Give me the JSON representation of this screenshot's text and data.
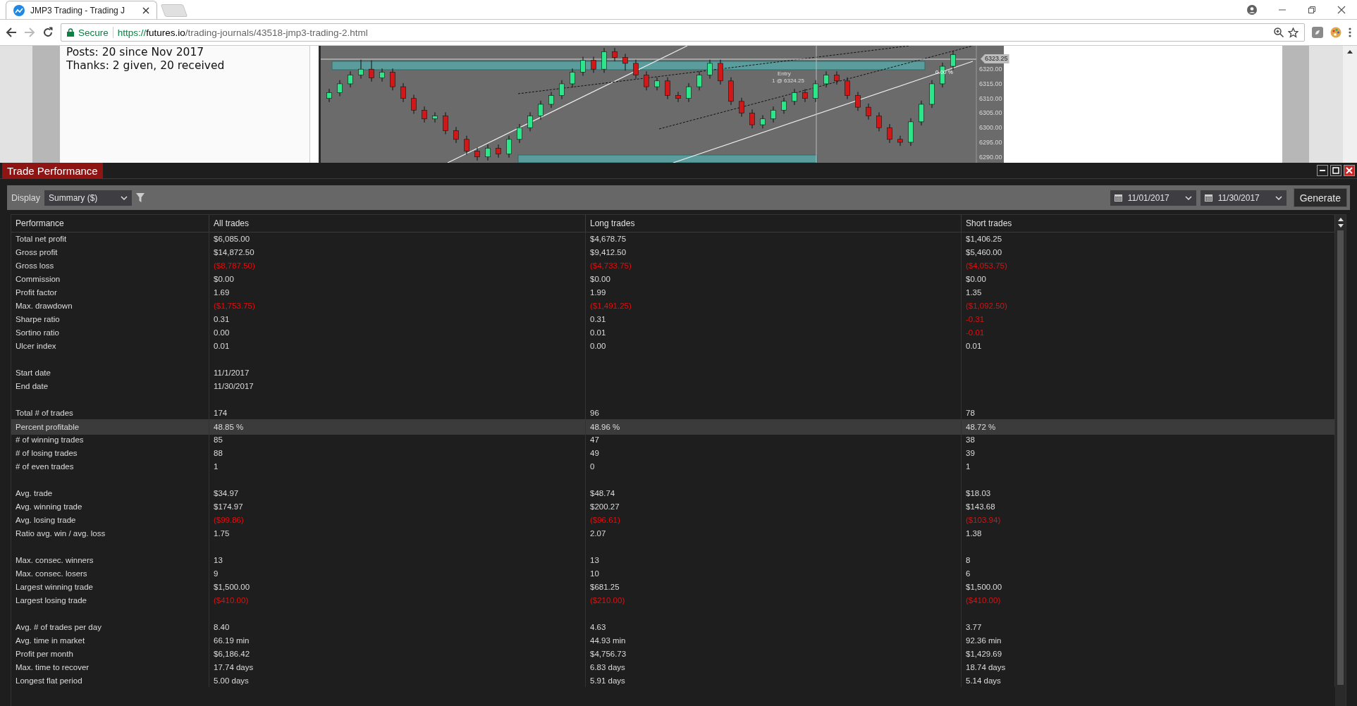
{
  "browser": {
    "tab_title": "JMP3 Trading - Trading J",
    "secure_label": "Secure",
    "url_scheme": "https://",
    "url_host": "futures.io",
    "url_path": "/trading-journals/43518-jmp3-trading-2.html"
  },
  "forum_post": {
    "lines": [
      "Posts: 20 since Nov 2017",
      "Thanks: 2 given, 20 received"
    ]
  },
  "chart": {
    "price_marker": "6323.25",
    "entry_label": "Entry",
    "entry_detail": "1 @ 6324.25",
    "percent_label": "0.00 %",
    "chart_data": {
      "type": "candlestick",
      "ylim": [
        6288,
        6328
      ],
      "yticks": [
        {
          "value": 6320,
          "label": "6320.00"
        },
        {
          "value": 6315,
          "label": "6315.00"
        },
        {
          "value": 6310,
          "label": "6310.00"
        },
        {
          "value": 6305,
          "label": "6305.00"
        },
        {
          "value": 6300,
          "label": "6300.00"
        },
        {
          "value": 6295,
          "label": "6295.00"
        },
        {
          "value": 6290,
          "label": "6290.00"
        }
      ],
      "ohlc": [
        [
          6310,
          6313.25,
          6308.75,
          6312
        ],
        [
          6312,
          6316.25,
          6310.75,
          6315
        ],
        [
          6315,
          6319.25,
          6313.75,
          6318
        ],
        [
          6318,
          6323.25,
          6316.75,
          6320
        ],
        [
          6320,
          6323,
          6315.75,
          6317
        ],
        [
          6317,
          6320.25,
          6315.75,
          6319
        ],
        [
          6319,
          6320.25,
          6312.75,
          6314
        ],
        [
          6314,
          6315.25,
          6308.75,
          6310
        ],
        [
          6310,
          6311.25,
          6304.75,
          6306
        ],
        [
          6306,
          6307.25,
          6301.75,
          6303
        ],
        [
          6303,
          6305.25,
          6301.75,
          6304
        ],
        [
          6304,
          6305.25,
          6297.75,
          6299
        ],
        [
          6299,
          6300.25,
          6294.75,
          6296
        ],
        [
          6296,
          6297.25,
          6290.75,
          6292
        ],
        [
          6292,
          6293.25,
          6288.75,
          6290
        ],
        [
          6290,
          6294.25,
          6288.75,
          6293
        ],
        [
          6293,
          6294.25,
          6289.75,
          6291
        ],
        [
          6291,
          6297.25,
          6289.75,
          6296
        ],
        [
          6296,
          6301.25,
          6294.75,
          6300
        ],
        [
          6300,
          6305.25,
          6298.75,
          6304
        ],
        [
          6304,
          6309.25,
          6302.75,
          6308
        ],
        [
          6308,
          6312.25,
          6306.75,
          6311
        ],
        [
          6311,
          6316.25,
          6309.75,
          6315
        ],
        [
          6315,
          6320.25,
          6313.75,
          6319
        ],
        [
          6319,
          6324.25,
          6317.75,
          6323
        ],
        [
          6323,
          6324.25,
          6318.75,
          6320
        ],
        [
          6320,
          6327.25,
          6318.75,
          6326
        ],
        [
          6326,
          6327.25,
          6322.75,
          6324
        ],
        [
          6324,
          6325.25,
          6319.5,
          6322
        ],
        [
          6322,
          6323.25,
          6316.75,
          6318
        ],
        [
          6318,
          6319.25,
          6312.75,
          6314
        ],
        [
          6314,
          6317.25,
          6312.75,
          6316
        ],
        [
          6316,
          6317.25,
          6309.75,
          6311
        ],
        [
          6311,
          6312.25,
          6308.75,
          6310
        ],
        [
          6310,
          6315.25,
          6308.75,
          6314
        ],
        [
          6314,
          6319.25,
          6312.75,
          6318
        ],
        [
          6318,
          6323.25,
          6316.75,
          6322
        ],
        [
          6322,
          6323.25,
          6314.75,
          6316
        ],
        [
          6316,
          6317.25,
          6307.75,
          6309
        ],
        [
          6309,
          6310.25,
          6303.75,
          6305
        ],
        [
          6305,
          6306.25,
          6299.75,
          6301
        ],
        [
          6301,
          6304.25,
          6299.75,
          6303
        ],
        [
          6303,
          6307.25,
          6301.75,
          6306
        ],
        [
          6306,
          6310.25,
          6304.75,
          6309
        ],
        [
          6309,
          6313.25,
          6307.75,
          6312
        ],
        [
          6312,
          6313.25,
          6308.75,
          6310
        ],
        [
          6310,
          6316.25,
          6308.75,
          6315
        ],
        [
          6315,
          6319.25,
          6313.75,
          6318
        ],
        [
          6318,
          6319.25,
          6314.75,
          6316
        ],
        [
          6316,
          6317.25,
          6309.75,
          6311
        ],
        [
          6311,
          6312.25,
          6305.75,
          6307
        ],
        [
          6307,
          6308.25,
          6302.75,
          6304
        ],
        [
          6304,
          6305.25,
          6298.75,
          6300
        ],
        [
          6300,
          6301.25,
          6294.75,
          6296
        ],
        [
          6296,
          6297.25,
          6293.75,
          6295
        ],
        [
          6295,
          6303.25,
          6293.75,
          6302
        ],
        [
          6302,
          6309.25,
          6300.75,
          6308
        ],
        [
          6308,
          6316.25,
          6306.75,
          6315
        ],
        [
          6315,
          6322.25,
          6313.75,
          6321
        ],
        [
          6321,
          6326.25,
          6319.75,
          6325
        ]
      ]
    }
  },
  "window": {
    "title": "Trade Performance"
  },
  "toolbar": {
    "display_label": "Display",
    "display_value": "Summary ($)",
    "start_date": "11/01/2017",
    "end_date": "11/30/2017",
    "generate": "Generate"
  },
  "table": {
    "columns": [
      "Performance",
      "All trades",
      "Long trades",
      "Short trades"
    ],
    "rows": [
      {
        "kind": "metric",
        "label": "Total net profit",
        "selected": false,
        "values": [
          {
            "text": "$6,085.00",
            "negative": false
          },
          {
            "text": "$4,678.75",
            "negative": false
          },
          {
            "text": "$1,406.25",
            "negative": false
          }
        ]
      },
      {
        "kind": "metric",
        "label": "Gross profit",
        "selected": false,
        "values": [
          {
            "text": "$14,872.50",
            "negative": false
          },
          {
            "text": "$9,412.50",
            "negative": false
          },
          {
            "text": "$5,460.00",
            "negative": false
          }
        ]
      },
      {
        "kind": "metric",
        "label": "Gross loss",
        "selected": false,
        "values": [
          {
            "text": "($8,787.50)",
            "negative": true
          },
          {
            "text": "($4,733.75)",
            "negative": true
          },
          {
            "text": "($4,053.75)",
            "negative": true
          }
        ]
      },
      {
        "kind": "metric",
        "label": "Commission",
        "selected": false,
        "values": [
          {
            "text": "$0.00",
            "negative": false
          },
          {
            "text": "$0.00",
            "negative": false
          },
          {
            "text": "$0.00",
            "negative": false
          }
        ]
      },
      {
        "kind": "metric",
        "label": "Profit factor",
        "selected": false,
        "values": [
          {
            "text": "1.69",
            "negative": false
          },
          {
            "text": "1.99",
            "negative": false
          },
          {
            "text": "1.35",
            "negative": false
          }
        ]
      },
      {
        "kind": "metric",
        "label": "Max. drawdown",
        "selected": false,
        "values": [
          {
            "text": "($1,753.75)",
            "negative": true
          },
          {
            "text": "($1,491.25)",
            "negative": true
          },
          {
            "text": "($1,092.50)",
            "negative": true
          }
        ]
      },
      {
        "kind": "metric",
        "label": "Sharpe ratio",
        "selected": false,
        "values": [
          {
            "text": "0.31",
            "negative": false
          },
          {
            "text": "0.31",
            "negative": false
          },
          {
            "text": "-0.31",
            "negative": true
          }
        ]
      },
      {
        "kind": "metric",
        "label": "Sortino ratio",
        "selected": false,
        "values": [
          {
            "text": "0.00",
            "negative": false
          },
          {
            "text": "0.01",
            "negative": false
          },
          {
            "text": "-0.01",
            "negative": true
          }
        ]
      },
      {
        "kind": "metric",
        "label": "Ulcer index",
        "selected": false,
        "values": [
          {
            "text": "0.01",
            "negative": false
          },
          {
            "text": "0.00",
            "negative": false
          },
          {
            "text": "0.01",
            "negative": false
          }
        ]
      },
      {
        "kind": "spacer"
      },
      {
        "kind": "metric",
        "label": "Start date",
        "selected": false,
        "values": [
          {
            "text": "11/1/2017",
            "negative": false
          }
        ]
      },
      {
        "kind": "metric",
        "label": "End date",
        "selected": false,
        "values": [
          {
            "text": "11/30/2017",
            "negative": false
          }
        ]
      },
      {
        "kind": "spacer"
      },
      {
        "kind": "metric",
        "label": "Total # of trades",
        "selected": false,
        "values": [
          {
            "text": "174",
            "negative": false
          },
          {
            "text": "96",
            "negative": false
          },
          {
            "text": "78",
            "negative": false
          }
        ]
      },
      {
        "kind": "metric",
        "label": "Percent profitable",
        "selected": true,
        "values": [
          {
            "text": "48.85 %",
            "negative": false
          },
          {
            "text": "48.96 %",
            "negative": false
          },
          {
            "text": "48.72 %",
            "negative": false
          }
        ]
      },
      {
        "kind": "metric",
        "label": "# of winning trades",
        "selected": false,
        "values": [
          {
            "text": "85",
            "negative": false
          },
          {
            "text": "47",
            "negative": false
          },
          {
            "text": "38",
            "negative": false
          }
        ]
      },
      {
        "kind": "metric",
        "label": "# of losing trades",
        "selected": false,
        "values": [
          {
            "text": "88",
            "negative": false
          },
          {
            "text": "49",
            "negative": false
          },
          {
            "text": "39",
            "negative": false
          }
        ]
      },
      {
        "kind": "metric",
        "label": "# of even trades",
        "selected": false,
        "values": [
          {
            "text": "1",
            "negative": false
          },
          {
            "text": "0",
            "negative": false
          },
          {
            "text": "1",
            "negative": false
          }
        ]
      },
      {
        "kind": "spacer"
      },
      {
        "kind": "metric",
        "label": "Avg. trade",
        "selected": false,
        "values": [
          {
            "text": "$34.97",
            "negative": false
          },
          {
            "text": "$48.74",
            "negative": false
          },
          {
            "text": "$18.03",
            "negative": false
          }
        ]
      },
      {
        "kind": "metric",
        "label": "Avg. winning trade",
        "selected": false,
        "values": [
          {
            "text": "$174.97",
            "negative": false
          },
          {
            "text": "$200.27",
            "negative": false
          },
          {
            "text": "$143.68",
            "negative": false
          }
        ]
      },
      {
        "kind": "metric",
        "label": "Avg. losing trade",
        "selected": false,
        "values": [
          {
            "text": "($99.86)",
            "negative": true
          },
          {
            "text": "($96.61)",
            "negative": true
          },
          {
            "text": "($103.94)",
            "negative": true
          }
        ]
      },
      {
        "kind": "metric",
        "label": "Ratio avg. win / avg. loss",
        "selected": false,
        "values": [
          {
            "text": "1.75",
            "negative": false
          },
          {
            "text": "2.07",
            "negative": false
          },
          {
            "text": "1.38",
            "negative": false
          }
        ]
      },
      {
        "kind": "spacer"
      },
      {
        "kind": "metric",
        "label": "Max. consec. winners",
        "selected": false,
        "values": [
          {
            "text": "13",
            "negative": false
          },
          {
            "text": "13",
            "negative": false
          },
          {
            "text": "8",
            "negative": false
          }
        ]
      },
      {
        "kind": "metric",
        "label": "Max. consec. losers",
        "selected": false,
        "values": [
          {
            "text": "9",
            "negative": false
          },
          {
            "text": "10",
            "negative": false
          },
          {
            "text": "6",
            "negative": false
          }
        ]
      },
      {
        "kind": "metric",
        "label": "Largest winning trade",
        "selected": false,
        "values": [
          {
            "text": "$1,500.00",
            "negative": false
          },
          {
            "text": "$681.25",
            "negative": false
          },
          {
            "text": "$1,500.00",
            "negative": false
          }
        ]
      },
      {
        "kind": "metric",
        "label": "Largest losing trade",
        "selected": false,
        "values": [
          {
            "text": "($410.00)",
            "negative": true
          },
          {
            "text": "($210.00)",
            "negative": true
          },
          {
            "text": "($410.00)",
            "negative": true
          }
        ]
      },
      {
        "kind": "spacer"
      },
      {
        "kind": "metric",
        "label": "Avg. # of trades per day",
        "selected": false,
        "values": [
          {
            "text": "8.40",
            "negative": false
          },
          {
            "text": "4.63",
            "negative": false
          },
          {
            "text": "3.77",
            "negative": false
          }
        ]
      },
      {
        "kind": "metric",
        "label": "Avg. time in market",
        "selected": false,
        "values": [
          {
            "text": "66.19 min",
            "negative": false
          },
          {
            "text": "44.93 min",
            "negative": false
          },
          {
            "text": "92.36 min",
            "negative": false
          }
        ]
      },
      {
        "kind": "metric",
        "label": "Profit per month",
        "selected": false,
        "values": [
          {
            "text": "$6,186.42",
            "negative": false
          },
          {
            "text": "$4,756.73",
            "negative": false
          },
          {
            "text": "$1,429.69",
            "negative": false
          }
        ]
      },
      {
        "kind": "metric",
        "label": "Max. time to recover",
        "selected": false,
        "values": [
          {
            "text": "17.74 days",
            "negative": false
          },
          {
            "text": "6.83 days",
            "negative": false
          },
          {
            "text": "18.74 days",
            "negative": false
          }
        ]
      },
      {
        "kind": "metric",
        "label": "Longest flat period",
        "selected": false,
        "values": [
          {
            "text": "5.00 days",
            "negative": false
          },
          {
            "text": "5.91 days",
            "negative": false
          },
          {
            "text": "5.14 days",
            "negative": false
          }
        ]
      }
    ]
  }
}
